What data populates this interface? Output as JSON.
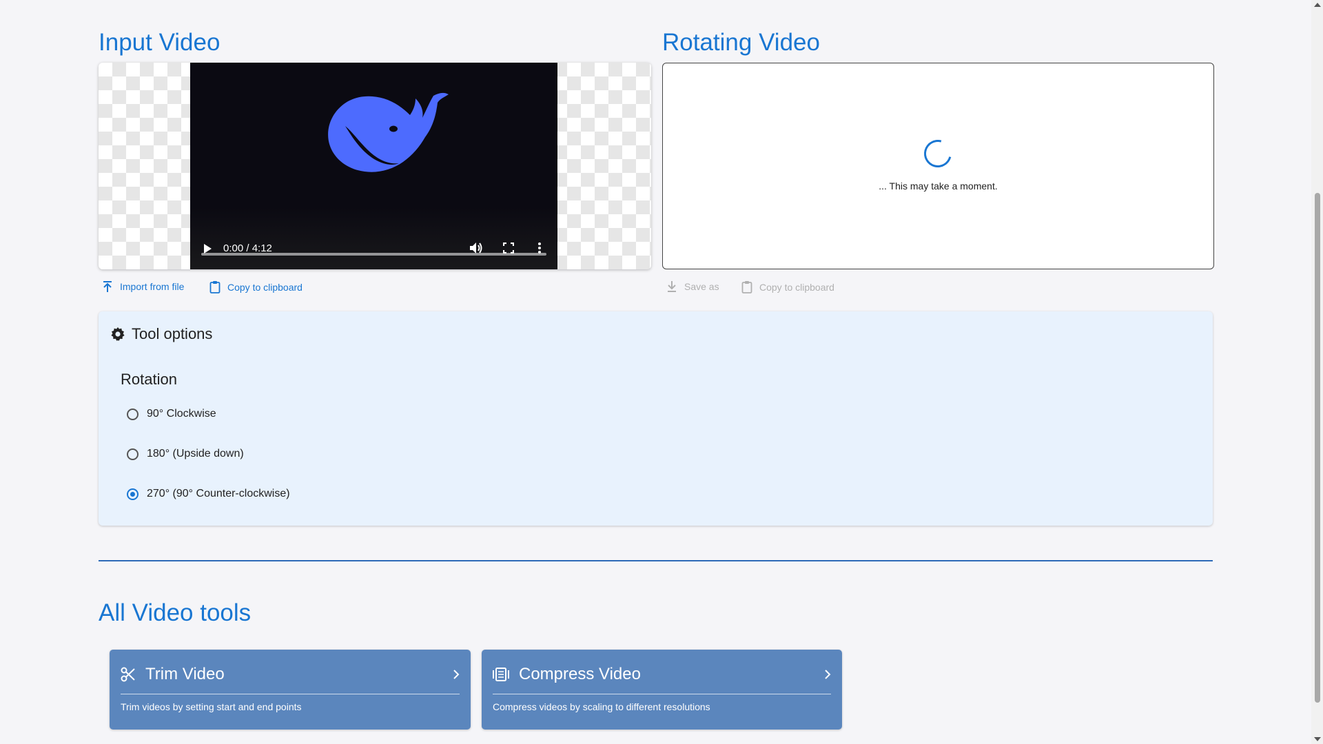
{
  "input": {
    "title": "Input Video",
    "video": {
      "time": "0:00 / 4:12"
    },
    "actions": {
      "import_label": "Import from file",
      "copy_label": "Copy to clipboard"
    }
  },
  "output": {
    "title": "Rotating Video",
    "loading_text": "... This may take a moment.",
    "actions": {
      "save_label": "Save as",
      "copy_label": "Copy to clipboard"
    }
  },
  "tool_options": {
    "header": "Tool options",
    "group_title": "Rotation",
    "options": [
      {
        "label": "90° Clockwise",
        "selected": false
      },
      {
        "label": "180° (Upside down)",
        "selected": false
      },
      {
        "label": "270° (90° Counter-clockwise)",
        "selected": true
      }
    ]
  },
  "all_tools": {
    "title": "All Video tools",
    "cards": [
      {
        "title": "Trim Video",
        "description": "Trim videos by setting start and end points",
        "icon": "scissors-icon"
      },
      {
        "title": "Compress Video",
        "description": "Compress videos by scaling to different resolutions",
        "icon": "compress-icon"
      }
    ]
  },
  "colors": {
    "accent": "#1976d2",
    "panel_bg": "#e8f2fd",
    "card_bg": "#5b86bd",
    "whale": "#4d6bfe"
  }
}
